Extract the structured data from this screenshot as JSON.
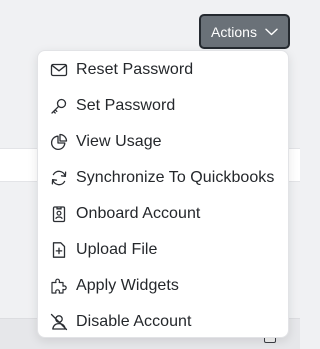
{
  "actions_button": {
    "label": "Actions",
    "icon": "chevron-down-icon"
  },
  "menu": {
    "items": [
      {
        "label": "Reset Password",
        "icon": "envelope-icon"
      },
      {
        "label": "Set Password",
        "icon": "key-icon"
      },
      {
        "label": "View Usage",
        "icon": "pie-chart-icon"
      },
      {
        "label": "Synchronize To Quickbooks",
        "icon": "sync-icon"
      },
      {
        "label": "Onboard Account",
        "icon": "badge-icon"
      },
      {
        "label": "Upload File",
        "icon": "file-plus-icon"
      },
      {
        "label": "Apply Widgets",
        "icon": "puzzle-icon"
      },
      {
        "label": "Disable Account",
        "icon": "user-slash-icon"
      }
    ]
  }
}
